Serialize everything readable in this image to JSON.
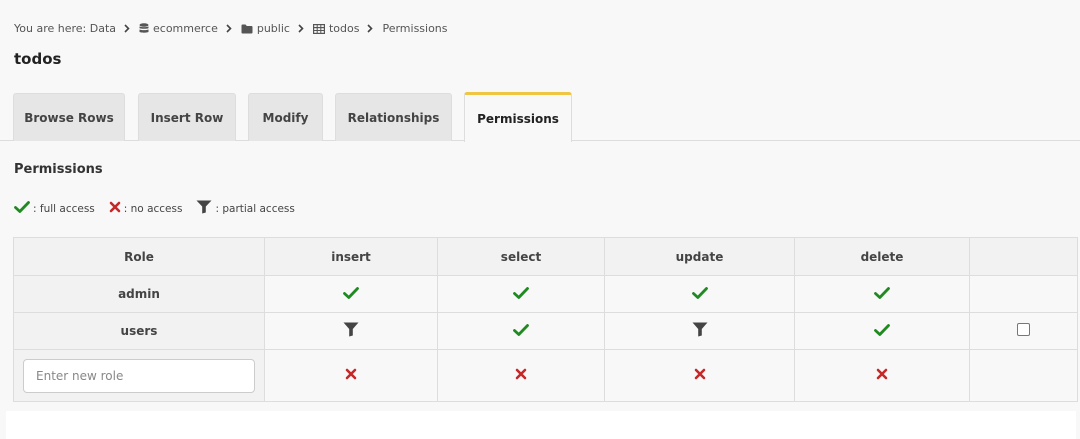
{
  "breadcrumb": {
    "prefix": "You are here: Data",
    "items": [
      {
        "label": "ecommerce",
        "icon": "database-icon"
      },
      {
        "label": "public",
        "icon": "folder-icon"
      },
      {
        "label": "todos",
        "icon": "table-icon"
      },
      {
        "label": "Permissions",
        "icon": ""
      }
    ]
  },
  "page_title": "todos",
  "tabs": [
    {
      "label": "Browse Rows",
      "active": false
    },
    {
      "label": "Insert Row",
      "active": false
    },
    {
      "label": "Modify",
      "active": false
    },
    {
      "label": "Relationships",
      "active": false
    },
    {
      "label": "Permissions",
      "active": true
    }
  ],
  "section_title": "Permissions",
  "legend": [
    {
      "icon": "check-icon",
      "label": ": full access"
    },
    {
      "icon": "cross-icon",
      "label": ": no access"
    },
    {
      "icon": "filter-icon",
      "label": ": partial access"
    }
  ],
  "table": {
    "headers": [
      "Role",
      "insert",
      "select",
      "update",
      "delete",
      ""
    ],
    "rows": [
      {
        "role": "admin",
        "insert": "full",
        "select": "full",
        "update": "full",
        "delete": "full"
      },
      {
        "role": "users",
        "insert": "partial",
        "select": "full",
        "update": "partial",
        "delete": "full"
      }
    ],
    "new_role": {
      "placeholder": "Enter new role",
      "value": "",
      "insert": "none",
      "select": "none",
      "update": "none",
      "delete": "none"
    }
  },
  "colors": {
    "full": "#1f8a1f",
    "none": "#c62828",
    "partial": "#444444",
    "active_tab_accent": "#f0c543"
  }
}
